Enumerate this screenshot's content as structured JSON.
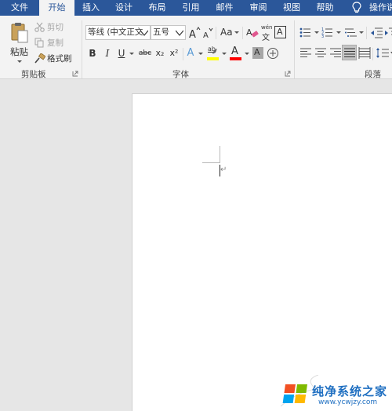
{
  "tabs": [
    {
      "label": "文件"
    },
    {
      "label": "开始"
    },
    {
      "label": "插入"
    },
    {
      "label": "设计"
    },
    {
      "label": "布局"
    },
    {
      "label": "引用"
    },
    {
      "label": "邮件"
    },
    {
      "label": "审阅"
    },
    {
      "label": "视图"
    },
    {
      "label": "帮助"
    }
  ],
  "active_tab": "开始",
  "tell_me": "操作说",
  "clipboard": {
    "paste": "粘贴",
    "cut": "剪切",
    "copy": "复制",
    "format_painter": "格式刷",
    "group_label": "剪贴板"
  },
  "font": {
    "font_name": "等线 (中文正文",
    "font_size": "五号",
    "case_label": "Aa",
    "phonetic_top": "wén",
    "phonetic_bottom": "文",
    "char_border": "A",
    "bold": "B",
    "italic": "I",
    "underline": "U",
    "strike": "abc",
    "subscript": "x₂",
    "superscript": "x²",
    "text_effect": "A",
    "highlight": "ab",
    "font_color": "A",
    "char_shading": "A",
    "group_label": "字体"
  },
  "paragraph": {
    "group_label": "段落"
  },
  "watermark": {
    "title": "纯净系统之家",
    "url": "www.ycwjzy.com"
  },
  "colors": {
    "tab_bar": "#2b579a",
    "ribbon": "#f3f3f3",
    "highlight": "#ffff00",
    "font_color": "#ff0000"
  }
}
